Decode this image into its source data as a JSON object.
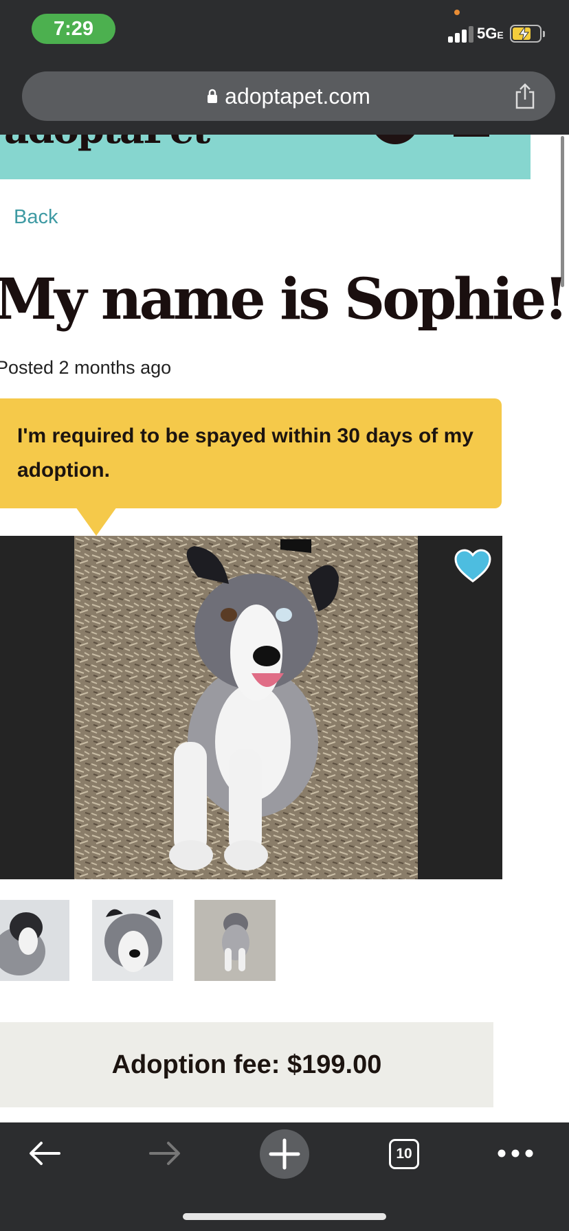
{
  "status_bar": {
    "time": "7:29",
    "network": "5G",
    "network_suffix": "E",
    "time_pill_color": "#4cb04f",
    "battery_color": "#f4cd3c"
  },
  "url_bar": {
    "url": "adoptapet.com",
    "lock_icon": "lock-icon",
    "share_icon": "share-icon"
  },
  "site": {
    "header_color": "#86d6cf",
    "accent_color": "#3e9aa3"
  },
  "page": {
    "back_label": "Back",
    "title": "My name is Sophie!",
    "posted": "Posted 2 months ago",
    "notice": "I'm required to be spayed within 30 days of my adoption.",
    "notice_color": "#f5c94a",
    "favorite_icon": "heart-icon",
    "favorite_color": "#4dbde0",
    "photos": [
      {
        "description": "dog-photo-1"
      },
      {
        "description": "dog-photo-2"
      },
      {
        "description": "dog-photo-3"
      }
    ],
    "adoption_fee": "Adoption fee: $199.00"
  },
  "toolbar": {
    "back_icon": "arrow-left-icon",
    "forward_icon": "arrow-right-icon",
    "new_tab_icon": "plus-icon",
    "tab_count": "10",
    "more_icon": "more-icon"
  }
}
